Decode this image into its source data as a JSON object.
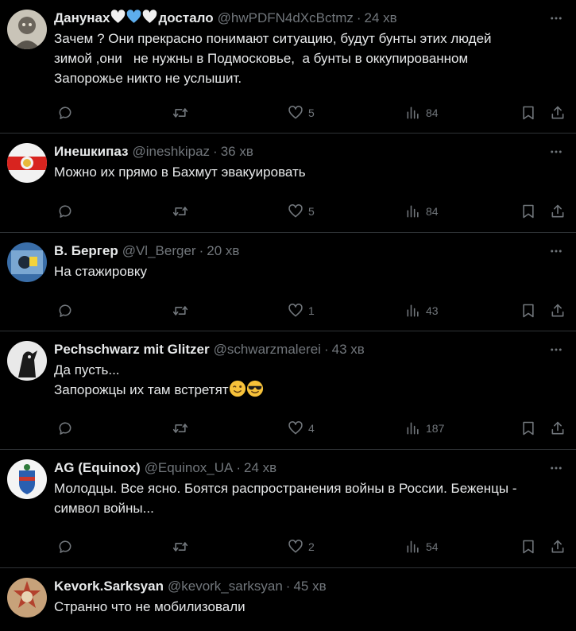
{
  "tweets": [
    {
      "name_pre": "Данунах",
      "name_post": "достало",
      "name_hearts": [
        "white",
        "blue",
        "white"
      ],
      "handle": "@hwPDFN4dXcBctmz",
      "time": "24 хв",
      "text": "Зачем ? Они прекрасно понимают ситуацию, будут бунты этих людей\nзимой ,они   не нужны в Подмосковье,  а бунты в оккупированном\nЗапорожье никто не услышит.",
      "likes": "5",
      "views": "84"
    },
    {
      "name": "Инешкипаз",
      "handle": "@ineshkipaz",
      "time": "36 хв",
      "text": "Можно их прямо в Бахмут эвакуировать",
      "likes": "5",
      "views": "84"
    },
    {
      "name": "В. Бергер",
      "handle": "@Vl_Berger",
      "time": "20 хв",
      "text": "На стажировку",
      "likes": "1",
      "views": "43"
    },
    {
      "name": "Pechschwarz mit Glitzer",
      "handle": "@schwarzmalerei",
      "time": "43 хв",
      "text_line1": "Да пусть...",
      "text_line2": "Запорожцы их там встретят",
      "emojis": [
        "winking-face",
        "smiling-face-with-sunglasses"
      ],
      "likes": "4",
      "views": "187"
    },
    {
      "name": "AG (Equinox)",
      "handle": "@Equinox_UA",
      "time": "24 хв",
      "text": "Молодцы. Все ясно. Боятся распространения войны в России. Беженцы -\nсимвол войны...",
      "likes": "2",
      "views": "54"
    },
    {
      "name": "Kevork.Sarksyan",
      "handle": "@kevork_sarksyan",
      "time": "45 хв",
      "text": "Странно что не мобилизовали"
    }
  ],
  "colors": {
    "background": "#000000",
    "text": "#e7e9ea",
    "muted": "#71767b",
    "divider": "#2f3336",
    "heart_blue": "#5dadec"
  },
  "icons": [
    "reply-icon",
    "retweet-icon",
    "like-icon",
    "views-icon",
    "bookmark-icon",
    "share-icon",
    "more-icon"
  ]
}
